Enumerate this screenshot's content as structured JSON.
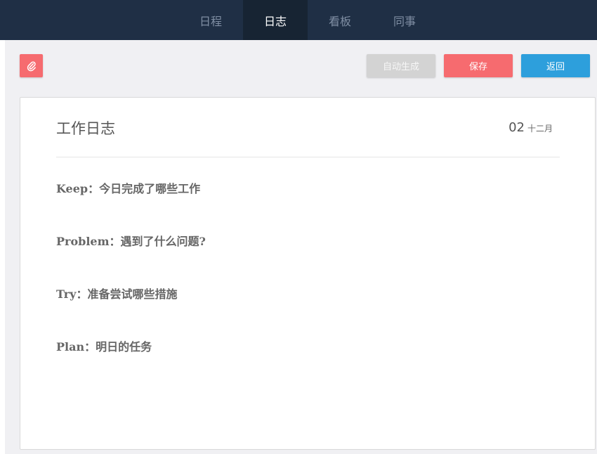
{
  "nav": {
    "tabs": [
      {
        "label": "日程",
        "active": false
      },
      {
        "label": "日志",
        "active": true
      },
      {
        "label": "看板",
        "active": false
      },
      {
        "label": "同事",
        "active": false
      }
    ]
  },
  "toolbar": {
    "attach_icon": "paperclip-icon",
    "autogen_label": "自动生成",
    "save_label": "保存",
    "back_label": "返回"
  },
  "log": {
    "title": "工作日志",
    "date_day": "02",
    "date_month": "十二月",
    "entries": [
      {
        "label": "Keep：今日完成了哪些工作"
      },
      {
        "label": "Problem：遇到了什么问题?"
      },
      {
        "label": "Try：准备尝试哪些措施"
      },
      {
        "label": "Plan：明日的任务"
      }
    ]
  },
  "colors": {
    "nav_bg": "#1f2f45",
    "nav_active_bg": "#172433",
    "red": "#f66b6f",
    "blue": "#2d9fdc",
    "gray_button": "#d3d3d3"
  }
}
